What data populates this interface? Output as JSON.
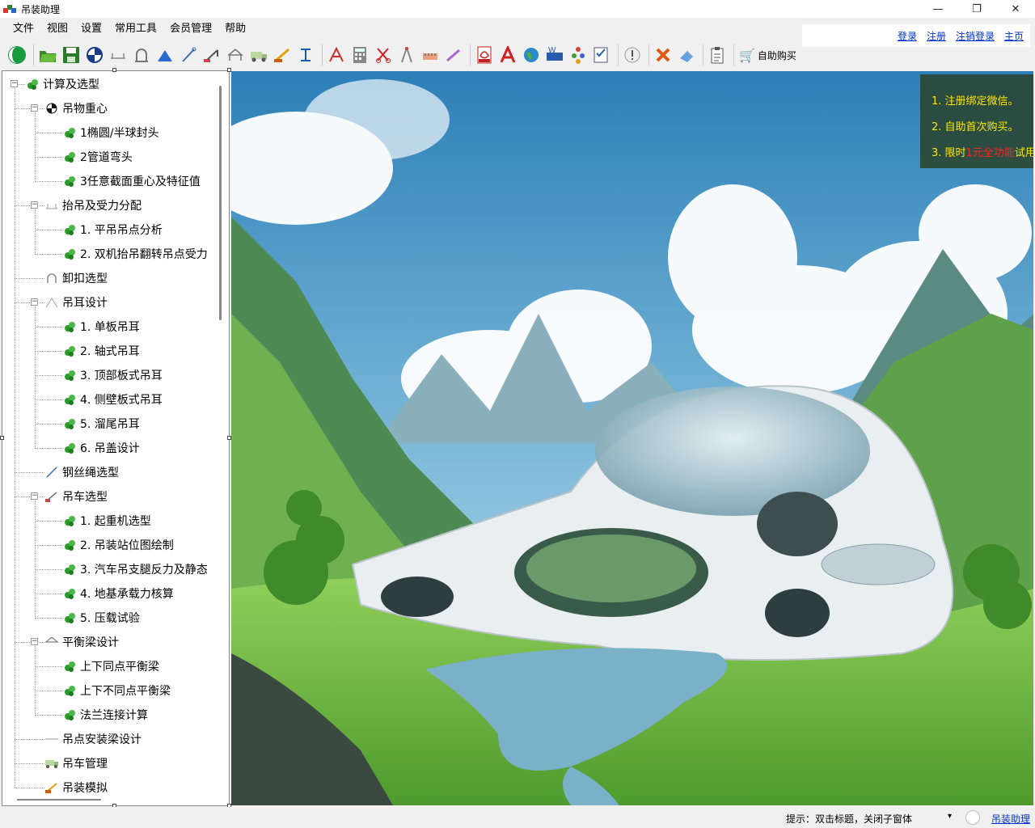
{
  "window": {
    "title": "吊装助理",
    "controls": {
      "minimize": "—",
      "maximize": "❐",
      "close": "✕"
    }
  },
  "menu": [
    "文件",
    "视图",
    "设置",
    "常用工具",
    "会员管理",
    "帮助"
  ],
  "top_links": [
    "登录",
    "注册",
    "注销登录",
    "主页"
  ],
  "toolbar": {
    "buy_label": "自助购买",
    "icons": [
      "toggle-icon",
      "open-folder-icon",
      "save-icon",
      "center-of-gravity-icon",
      "beam-icon",
      "shackle-icon",
      "lug-icon",
      "wire-rope-icon",
      "crane-icon",
      "balance-beam-icon",
      "truck-icon",
      "excavator-icon",
      "i-beam-icon",
      "drawing-tool-icon",
      "calculator-icon",
      "scissors-icon",
      "compass-icon",
      "measure-icon",
      "pen-icon",
      "pdf-icon",
      "text-icon",
      "globe-icon",
      "word-icon",
      "tree-icon",
      "checklist-icon",
      "info-icon",
      "cancel-icon",
      "eraser-icon",
      "clipboard-icon",
      "cart-icon"
    ]
  },
  "tree": [
    {
      "label": "计算及选型",
      "level": 0,
      "icon": "leaf"
    },
    {
      "label": "吊物重心",
      "level": 1,
      "icon": "gravity"
    },
    {
      "label": "1椭圆/半球封头",
      "level": 2,
      "icon": "leaf"
    },
    {
      "label": "2管道弯头",
      "level": 2,
      "icon": "leaf"
    },
    {
      "label": "3任意截面重心及特征值",
      "level": 2,
      "icon": "leaf"
    },
    {
      "label": "抬吊及受力分配",
      "level": 1,
      "icon": "beam"
    },
    {
      "label": "1. 平吊吊点分析",
      "level": 2,
      "icon": "leaf"
    },
    {
      "label": "2. 双机抬吊翻转吊点受力",
      "level": 2,
      "icon": "leaf"
    },
    {
      "label": "卸扣选型",
      "level": 1,
      "icon": "shackle"
    },
    {
      "label": "吊耳设计",
      "level": 1,
      "icon": "lug"
    },
    {
      "label": "1. 单板吊耳",
      "level": 2,
      "icon": "leaf"
    },
    {
      "label": "2. 轴式吊耳",
      "level": 2,
      "icon": "leaf"
    },
    {
      "label": "3. 顶部板式吊耳",
      "level": 2,
      "icon": "leaf"
    },
    {
      "label": "4. 侧壁板式吊耳",
      "level": 2,
      "icon": "leaf"
    },
    {
      "label": "5. 溜尾吊耳",
      "level": 2,
      "icon": "leaf"
    },
    {
      "label": "6. 吊盖设计",
      "level": 2,
      "icon": "leaf"
    },
    {
      "label": "钢丝绳选型",
      "level": 1,
      "icon": "rope"
    },
    {
      "label": "吊车选型",
      "level": 1,
      "icon": "crane"
    },
    {
      "label": "1. 起重机选型",
      "level": 2,
      "icon": "leaf"
    },
    {
      "label": "2. 吊装站位图绘制",
      "level": 2,
      "icon": "leaf"
    },
    {
      "label": "3. 汽车吊支腿反力及静态",
      "level": 2,
      "icon": "leaf"
    },
    {
      "label": "4. 地基承载力核算",
      "level": 2,
      "icon": "leaf"
    },
    {
      "label": "5. 压载试验",
      "level": 2,
      "icon": "leaf"
    },
    {
      "label": "平衡梁设计",
      "level": 1,
      "icon": "balance"
    },
    {
      "label": "上下同点平衡梁",
      "level": 2,
      "icon": "leaf"
    },
    {
      "label": "上下不同点平衡梁",
      "level": 2,
      "icon": "leaf"
    },
    {
      "label": "法兰连接计算",
      "level": 2,
      "icon": "leaf"
    },
    {
      "label": "吊点安装梁设计",
      "level": 1,
      "icon": "line"
    },
    {
      "label": "吊车管理",
      "level": 1,
      "icon": "truck"
    },
    {
      "label": "吊装模拟",
      "level": 1,
      "icon": "excavator"
    }
  ],
  "promo": {
    "line1": "1. 注册绑定微信。",
    "line2": "2. 自助首次购买。",
    "line3_prefix": "3. 限时",
    "line3_highlight": "1元全功能",
    "line3_suffix": "试用。"
  },
  "status": {
    "hint": "提示：双击标题，关闭子窗体",
    "app_link": "吊装助理"
  },
  "colors": {
    "link": "#0033cc",
    "promo_text": "#ffe600",
    "promo_highlight": "#ff2020"
  }
}
